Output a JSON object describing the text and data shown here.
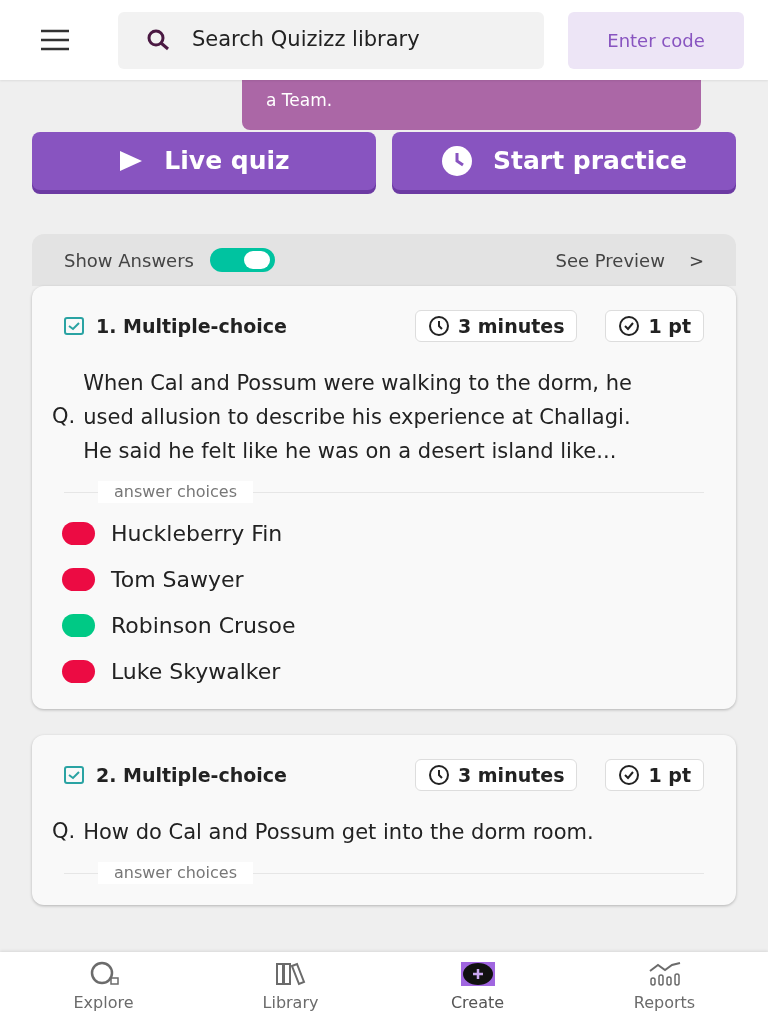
{
  "header": {
    "search_placeholder": "Search Quizizz library",
    "enter_code": "Enter code"
  },
  "tooltip": {
    "text": "a Team."
  },
  "actions": [
    {
      "kind": "play",
      "label": "Live quiz"
    },
    {
      "kind": "clock",
      "label": "Start practice"
    }
  ],
  "panel": {
    "show_answers": {
      "label": "Show Answers",
      "on": true
    },
    "preview": {
      "label": "See Preview",
      "chevron": ">"
    }
  },
  "questions": [
    {
      "title": "1. Multiple-choice",
      "time": "3 minutes",
      "points": "1 pt",
      "q_mark": "Q.",
      "text": "When Cal and Possum were walking to the dorm, he used allusion to describe his experience at Challagi. He said he felt like he was on a desert island like...",
      "answer_label": "answer choices",
      "choices": [
        {
          "text": "Huckleberry Fin",
          "correct": false
        },
        {
          "text": "Tom Sawyer",
          "correct": false
        },
        {
          "text": "Robinson Crusoe",
          "correct": true
        },
        {
          "text": "Luke Skywalker",
          "correct": false
        }
      ]
    },
    {
      "title": "2. Multiple-choice",
      "time": "3 minutes",
      "points": "1 pt",
      "q_mark": "Q.",
      "text": "How do Cal and Possum get into the dorm room.",
      "answer_label": "answer choices"
    }
  ],
  "nav": [
    {
      "kind": "explore",
      "label": "Explore",
      "selected": false
    },
    {
      "kind": "library",
      "label": "Library",
      "selected": false
    },
    {
      "kind": "create",
      "label": "Create",
      "selected": true
    },
    {
      "kind": "reports",
      "label": "Reports",
      "selected": false
    }
  ]
}
